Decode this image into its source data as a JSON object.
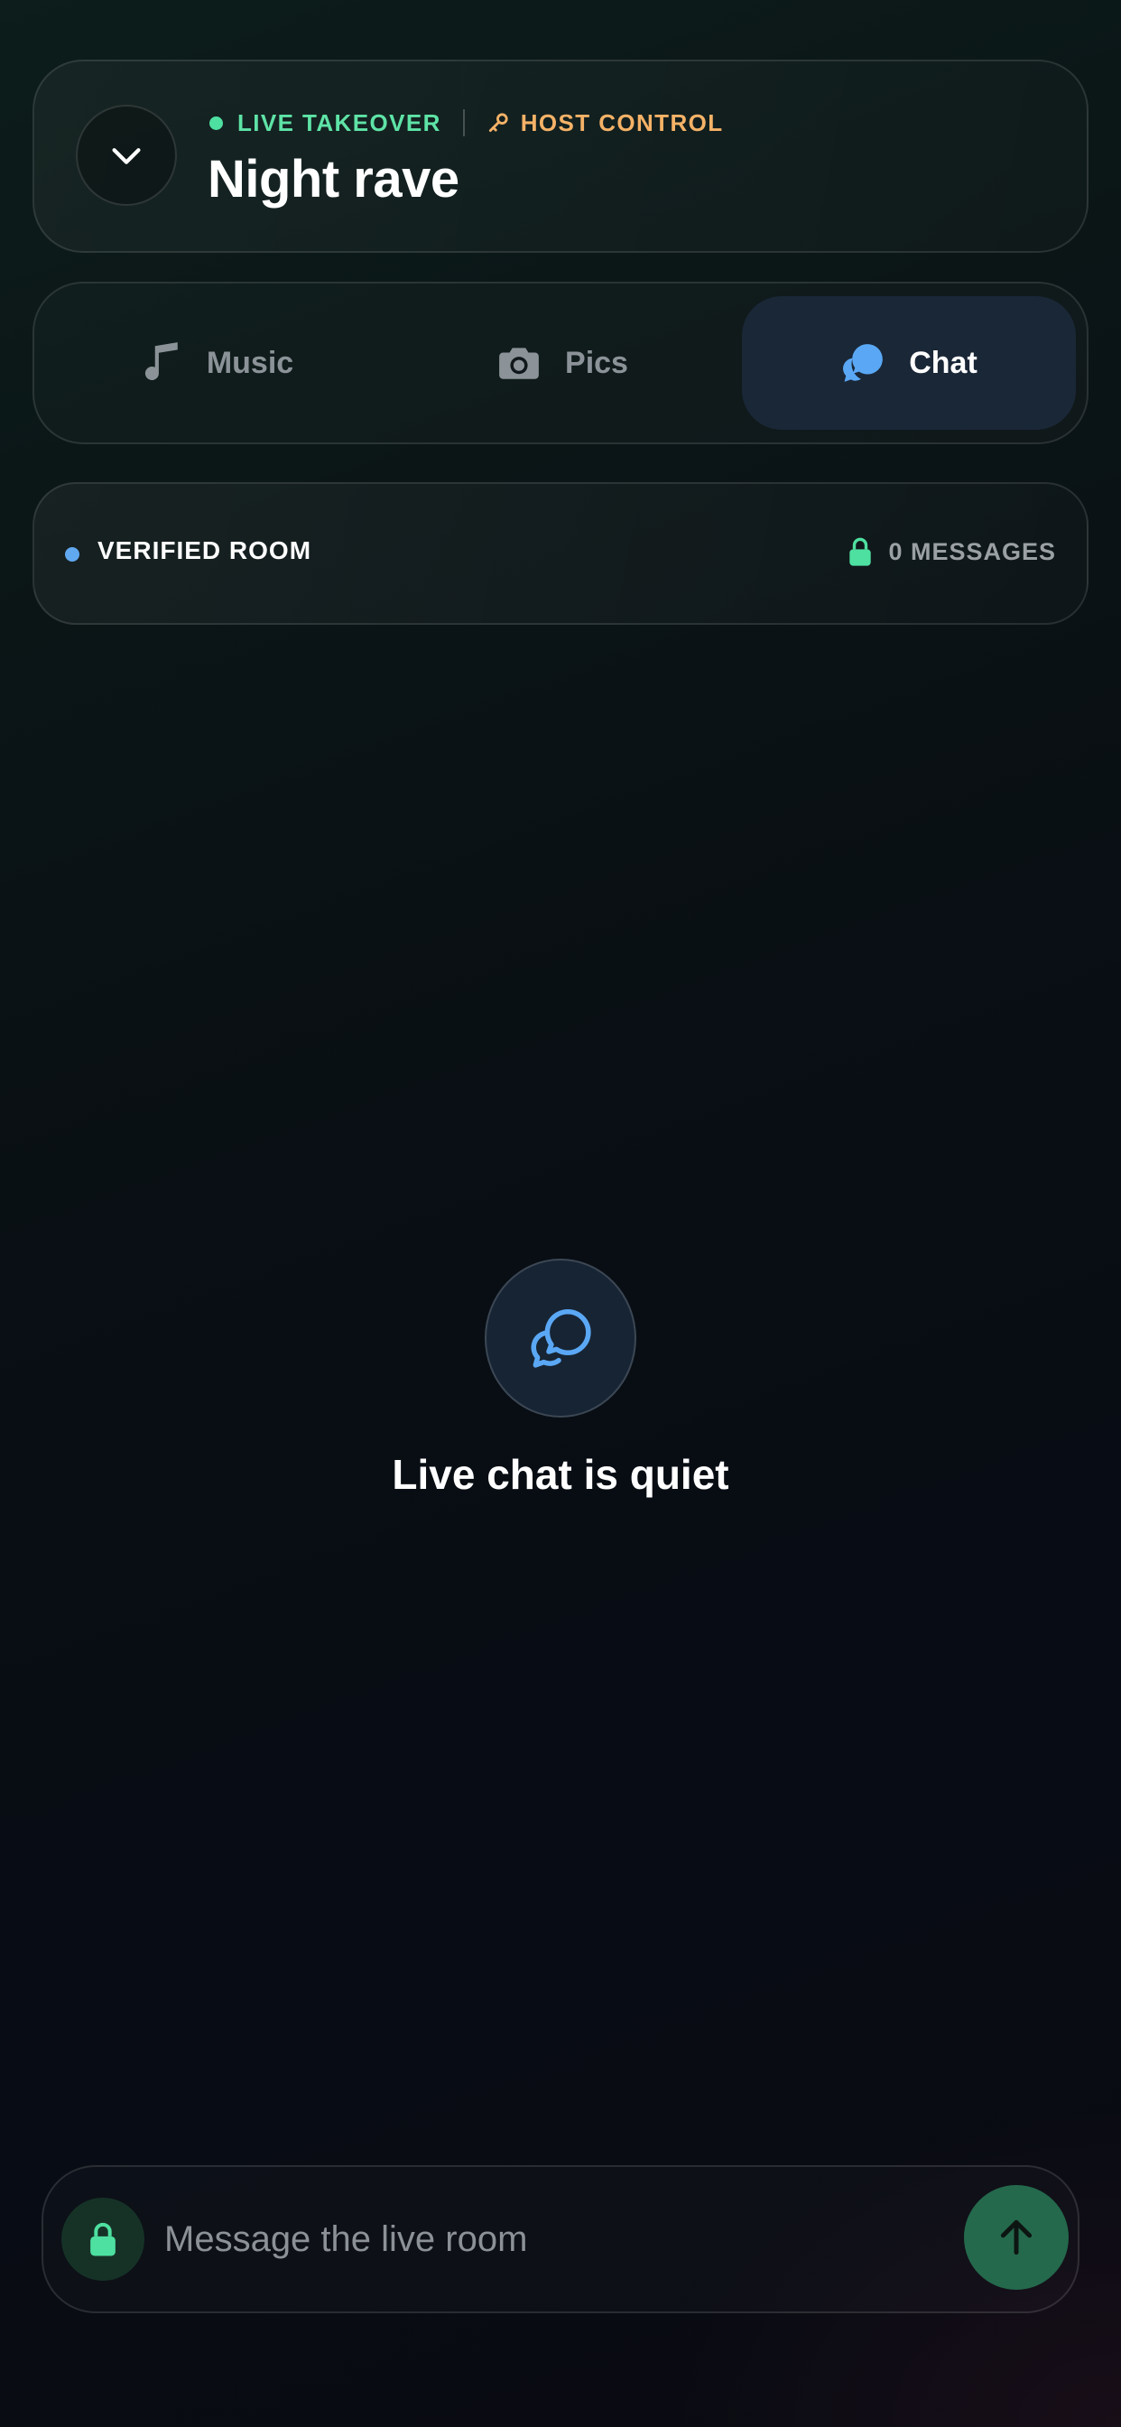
{
  "header": {
    "back_icon": "chevron-down-icon",
    "live_label": "LIVE TAKEOVER",
    "host_icon": "key-icon",
    "host_label": "HOST CONTROL",
    "title": "Night rave"
  },
  "tabs": [
    {
      "label": "Music",
      "icon": "music-note-icon",
      "active": false
    },
    {
      "label": "Pics",
      "icon": "camera-icon",
      "active": false
    },
    {
      "label": "Chat",
      "icon": "chat-bubbles-icon",
      "active": true
    }
  ],
  "room_status": {
    "verified_label": "VERIFIED ROOM",
    "lock_icon": "lock-icon",
    "message_count": "0 MESSAGES"
  },
  "empty_state": {
    "icon": "chat-bubbles-icon",
    "title": "Live chat is quiet"
  },
  "composer": {
    "lock_icon": "lock-icon",
    "input_value": "",
    "placeholder": "Message the live room",
    "send_icon": "arrow-up-icon"
  },
  "colors": {
    "live_green": "#5ee3a6",
    "host_orange": "#f5b267",
    "verified_blue": "#60a8f0",
    "chat_accent_blue": "#5aa8f5",
    "active_tab_bg": "#1a2737",
    "send_button_bg": "#24694c"
  }
}
